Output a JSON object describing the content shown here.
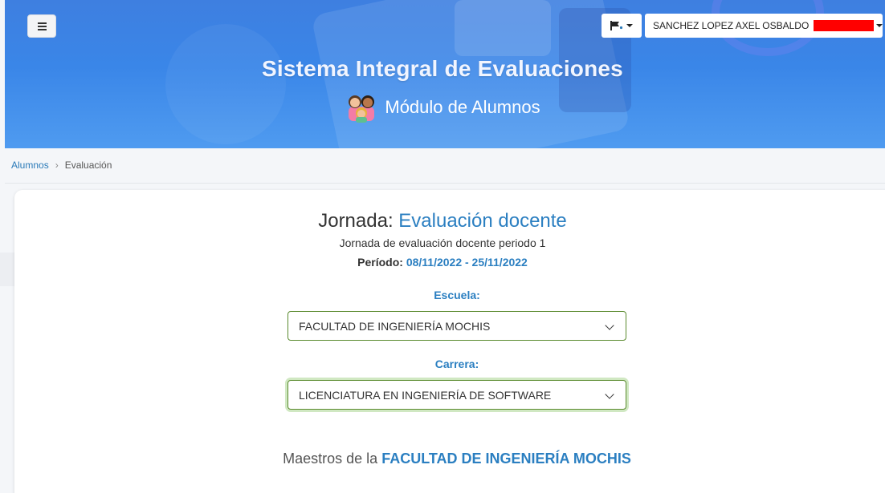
{
  "header": {
    "title": "Sistema Integral de Evaluaciones",
    "subtitle": "Módulo de Alumnos",
    "menu_icon": "hamburger-icon",
    "flag_icon": "flag-icon",
    "user_name": "SANCHEZ LOPEZ AXEL OSBALDO"
  },
  "breadcrumb": {
    "items": [
      "Alumnos",
      "Evaluación"
    ]
  },
  "jornada": {
    "label": "Jornada:",
    "name": "Evaluación docente",
    "description": "Jornada de evaluación docente periodo 1",
    "periodo_label": "Período:",
    "periodo_dates": "08/11/2022 - 25/11/2022"
  },
  "form": {
    "escuela_label": "Escuela:",
    "escuela_value": "FACULTAD DE INGENIERÍA MOCHIS",
    "carrera_label": "Carrera:",
    "carrera_value": "LICENCIATURA EN INGENIERÍA DE SOFTWARE"
  },
  "maestros": {
    "prefix": "Maestros de la",
    "school": "FACULTAD DE INGENIERÍA MOCHIS"
  },
  "colors": {
    "accent": "#2b7fc1",
    "banner": "#3a86e8",
    "select_border": "#5a8a2e"
  }
}
